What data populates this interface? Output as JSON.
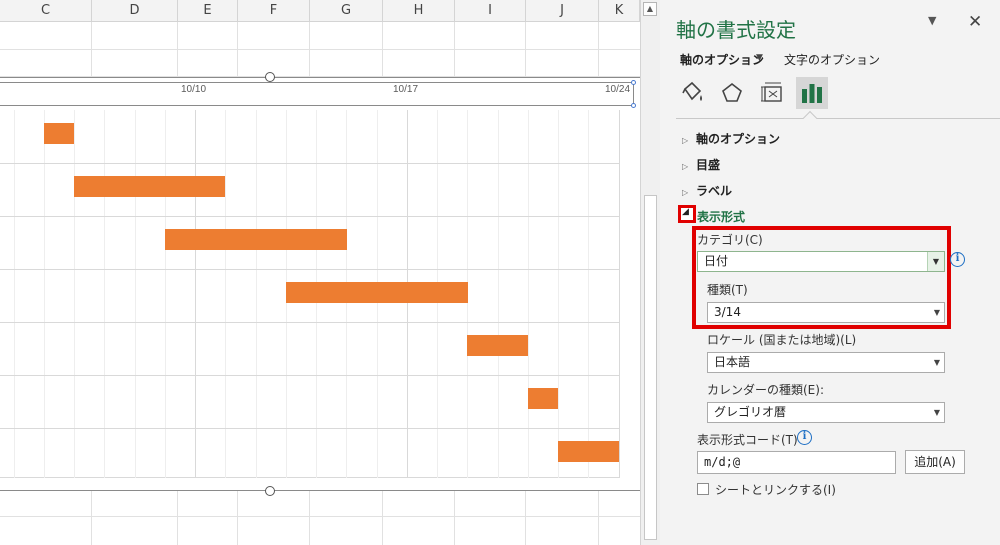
{
  "sheet": {
    "columns": [
      "C",
      "D",
      "E",
      "F",
      "G",
      "H",
      "I",
      "J",
      "K"
    ],
    "tick_labels": [
      "10/10",
      "10/17",
      "10/24"
    ],
    "bar_color": "#ed7d31"
  },
  "pane": {
    "title": "軸の書式設定",
    "tabs": {
      "axis_options": "軸のオプション",
      "text_options": "文字のオプション"
    },
    "icons": [
      "fill-line-icon",
      "effects-icon",
      "size-properties-icon",
      "axis-options-icon"
    ],
    "sections": {
      "axis_options": "軸のオプション",
      "tick_marks": "目盛",
      "labels": "ラベル",
      "number": "表示形式"
    },
    "number": {
      "category_label": "カテゴリ(C)",
      "category_value": "日付",
      "type_label": "種類(T)",
      "type_value": "3/14",
      "locale_label": "ロケール (国または地域)(L)",
      "locale_value": "日本語",
      "calendar_label": "カレンダーの種類(E):",
      "calendar_value": "グレゴリオ暦",
      "format_code_label": "表示形式コード(T)",
      "format_code_value": "m/d;@",
      "add_button": "追加(A)",
      "link_label": "シートとリンクする(I)"
    },
    "info_glyph": "i",
    "accent_color": "#217346",
    "highlight_color": "#e00000"
  },
  "chart_data": {
    "type": "bar",
    "orientation": "horizontal",
    "x_tick_labels": [
      "10/10",
      "10/17",
      "10/24"
    ],
    "x_axis_format": "m/d",
    "series": [
      {
        "start": [
          "10/5",
          "10/6",
          "10/9",
          "10/13",
          "10/19",
          "10/21",
          "10/22"
        ],
        "end": [
          "10/6",
          "10/11",
          "10/15",
          "10/19",
          "10/21",
          "10/22",
          "10/24"
        ]
      }
    ],
    "grid": true
  }
}
